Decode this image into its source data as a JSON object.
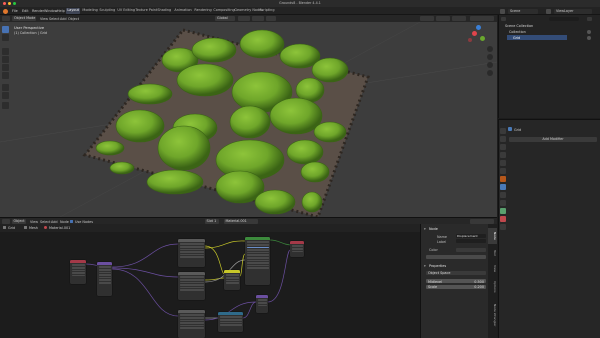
{
  "window": {
    "title": "Groundv8 - Blender 4.4.1"
  },
  "menu": [
    "File",
    "Edit",
    "Render",
    "Window",
    "Help"
  ],
  "workspaces": [
    "Layout",
    "Modeling",
    "Sculpting",
    "UV Editing",
    "Texture Paint",
    "Shading",
    "Animation",
    "Rendering",
    "Compositing",
    "Geometry Nodes",
    "Scripting"
  ],
  "active_workspace": "Layout",
  "scene": {
    "label": "Scene",
    "view_layer": "ViewLayer"
  },
  "viewport": {
    "header": {
      "mode": "Object Mode",
      "menus": [
        "View",
        "Select",
        "Add",
        "Object"
      ],
      "orientation": "Global"
    },
    "overlay": {
      "line1": "User Perspective",
      "line2": "(1) Collection | Grid"
    },
    "ground_colors": {
      "moss": "#6fa62a",
      "moss_dark": "#3b6415",
      "soil": "#5a4f47"
    }
  },
  "outliner": {
    "title": "Scene Collection",
    "items": [
      "Collection",
      "Grid"
    ]
  },
  "properties": {
    "panel_title": "Grid",
    "button": "Add Modifier"
  },
  "node_editor": {
    "header": {
      "type": "Object",
      "menus": [
        "View",
        "Select",
        "Add",
        "Node"
      ],
      "use_nodes": "Use Nodes",
      "slot": "Slot 1",
      "material": "Material.001"
    },
    "toolbar": [
      "Grid",
      "Mesh",
      "Material.001"
    ],
    "nodes": [
      {
        "label": "Texture Coordinate",
        "color": "#a43948"
      },
      {
        "label": "Mapping",
        "color": "#6b4fa0"
      },
      {
        "label": "Noise Texture",
        "color": "#5a5a5a"
      },
      {
        "label": "Image Texture",
        "color": "#5a5a5a"
      },
      {
        "label": "Image Texture",
        "color": "#5a5a5a"
      },
      {
        "label": "Mix",
        "color": "#5a5a5a"
      },
      {
        "label": "Principled BSDF",
        "color": "#3c8a3c"
      },
      {
        "label": "Material Output",
        "color": "#a43948"
      },
      {
        "label": "Bump",
        "color": "#6b4fa0"
      },
      {
        "label": "Normal Map",
        "color": "#2f6a8a"
      }
    ]
  },
  "sidebar": {
    "node_section": "Node",
    "name_label": "Name",
    "name_value": "Displacement",
    "label_label": "Label",
    "color_label": "Color",
    "properties_section": "Properties",
    "space": "Object Space",
    "midlevel_label": "Midlevel",
    "midlevel_value": "0.500",
    "scale_label": "Scale",
    "scale_value": "0.200",
    "tabs": [
      "Node",
      "Tool",
      "View",
      "Options",
      "Node Wrangler"
    ]
  }
}
